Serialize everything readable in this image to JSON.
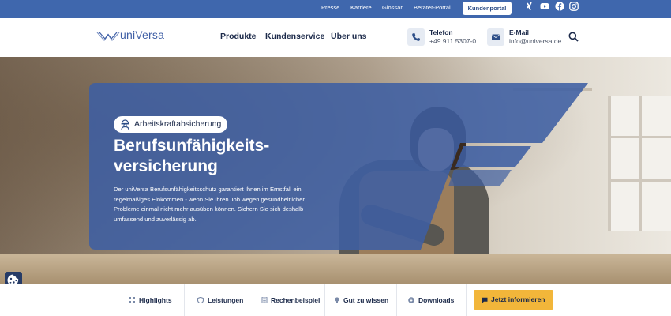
{
  "topbar": {
    "links": [
      "Presse",
      "Karriere",
      "Glossar",
      "Berater-Portal"
    ],
    "portal_label": "Kundenportal",
    "social_icons": [
      "xing-icon",
      "youtube-icon",
      "facebook-icon",
      "instagram-icon"
    ]
  },
  "header": {
    "logo_text": "uniVersa",
    "nav": [
      "Produkte",
      "Kundenservice",
      "Über uns"
    ],
    "phone": {
      "label": "Telefon",
      "value": "+49 911 5307-0"
    },
    "email": {
      "label": "E-Mail",
      "value": "info@universa.de"
    }
  },
  "hero": {
    "badge": "Arbeitskraftabsicherung",
    "title": "Berufsunfähigkeits-versicherung",
    "title_line1": "Berufsunfähigkeits-",
    "title_line2": "versicherung",
    "text": "Der uniVersa Berufsunfähigkeitsschutz garantiert Ihnen im Ernstfall ein regelmäßiges Einkommen - wenn Sie Ihren Job wegen gesundheitlicher Probleme einmal nicht mehr ausüben können. Sichern Sie sich deshalb umfassend und zuverlässig ab."
  },
  "tabs": [
    "Highlights",
    "Leistungen",
    "Rechenbeispiel",
    "Gut zu wissen",
    "Downloads"
  ],
  "cta_label": "Jetzt informieren",
  "colors": {
    "topbar": "#3f67ad",
    "overlay": "#3e5fa3",
    "cta": "#f2b63a",
    "text_dark": "#1c2a4a"
  }
}
